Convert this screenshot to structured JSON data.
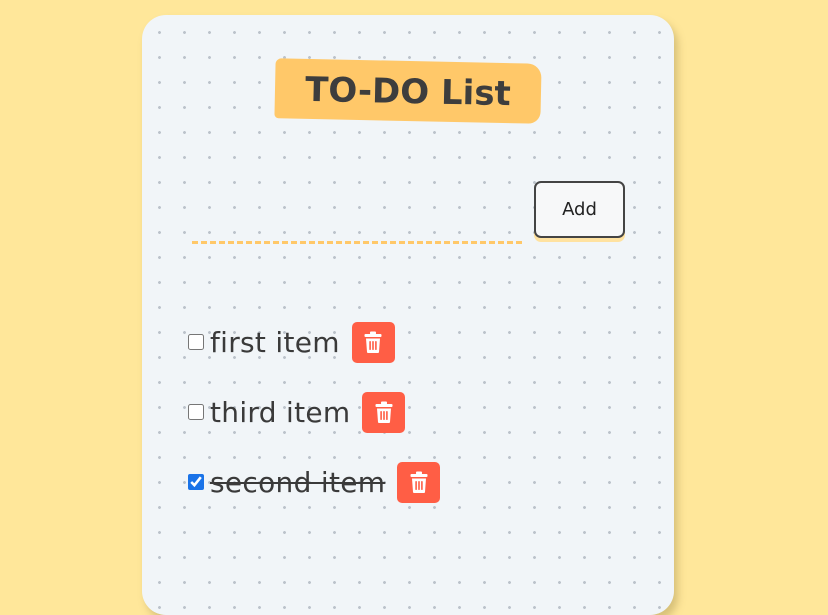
{
  "app": {
    "title": "TO-DO List"
  },
  "input": {
    "value": "",
    "placeholder": ""
  },
  "add_button": {
    "label": "Add"
  },
  "todos": [
    {
      "text": "first item",
      "checked": false
    },
    {
      "text": "third item",
      "checked": false
    },
    {
      "text": "second item",
      "checked": true
    }
  ],
  "colors": {
    "page_background": "#ffe79a",
    "card_background": "#f1f5f8",
    "title_badge": "#ffc869",
    "input_underline": "#ffc869",
    "delete_button": "#ff5e45",
    "text": "#3a3a3a"
  },
  "icons": {
    "delete": "trash-icon"
  }
}
